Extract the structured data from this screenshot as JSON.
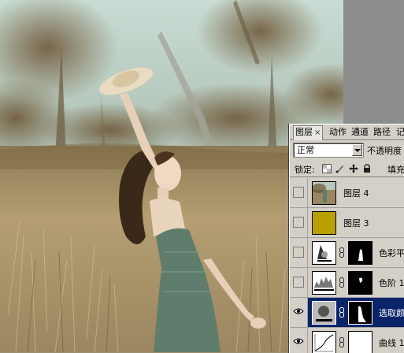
{
  "canvas": {
    "description_name": "photo-canvas"
  },
  "layers_panel": {
    "tabs": [
      {
        "label": "图层",
        "active": true,
        "closable": true
      },
      {
        "label": "动作",
        "active": false
      },
      {
        "label": "通道",
        "active": false
      },
      {
        "label": "路径",
        "active": false
      },
      {
        "label": "记",
        "active": false
      }
    ],
    "blend_mode": "正常",
    "opacity_label": "不透明度",
    "lock_label": "锁定:",
    "fill_label": "填充",
    "layers": [
      {
        "name": "图层 4",
        "visible": false,
        "type": "photo"
      },
      {
        "name": "图层 3",
        "visible": false,
        "type": "solid",
        "color": "#b8a000"
      },
      {
        "name": "色彩平",
        "visible": false,
        "type": "adjustment"
      },
      {
        "name": "色阶 1",
        "visible": false,
        "type": "levels"
      },
      {
        "name": "选取颜",
        "visible": true,
        "type": "selective",
        "selected": true
      },
      {
        "name": "曲线 1",
        "visible": true,
        "type": "curves"
      }
    ]
  },
  "colors": {
    "panel_bg": "#d4d0c8",
    "selection": "#0a246a",
    "sky": "#b8cfc4",
    "grass": "#a8926a"
  }
}
